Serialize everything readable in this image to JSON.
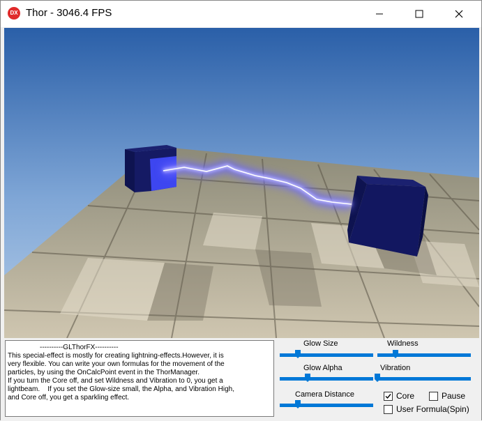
{
  "window": {
    "title": "Thor - 3046.4 FPS",
    "app_icon_text": "DX"
  },
  "description": {
    "heading": "----------GLThorFX----------",
    "lines": [
      "This special-effect is mostly for creating lightning-effects.However, it is",
      "very flexible. You can write your own formulas for the movement of the",
      "particles, by using the OnCalcPoint event in the ThorManager.",
      "If you turn the Core off, and set Wildness and Vibration to 0, you get a",
      "lightbeam.    If you set the Glow-size small, the Alpha, and Vibration High,",
      "and Core off, you get a sparkling effect."
    ]
  },
  "sliders": {
    "glow_size": {
      "label": "Glow Size",
      "value": 0.2
    },
    "wildness": {
      "label": "Wildness",
      "value": 0.2
    },
    "glow_alpha": {
      "label": "Glow Alpha",
      "value": 0.3
    },
    "vibration": {
      "label": "Vibration",
      "value": 0.0
    },
    "camera_distance": {
      "label": "Camera Distance",
      "value": 0.2
    }
  },
  "checkboxes": {
    "core": {
      "label": "Core",
      "checked": true
    },
    "pause": {
      "label": "Pause",
      "checked": false
    },
    "user_formula": {
      "label": "User Formula(Spin)",
      "checked": false
    }
  },
  "colors": {
    "accent": "#0078d7",
    "sky_top": "#2a5fa8",
    "sky_bottom": "#a6c3e3",
    "cube": "#141a5e",
    "lightning_glow": "#6e6bff"
  }
}
